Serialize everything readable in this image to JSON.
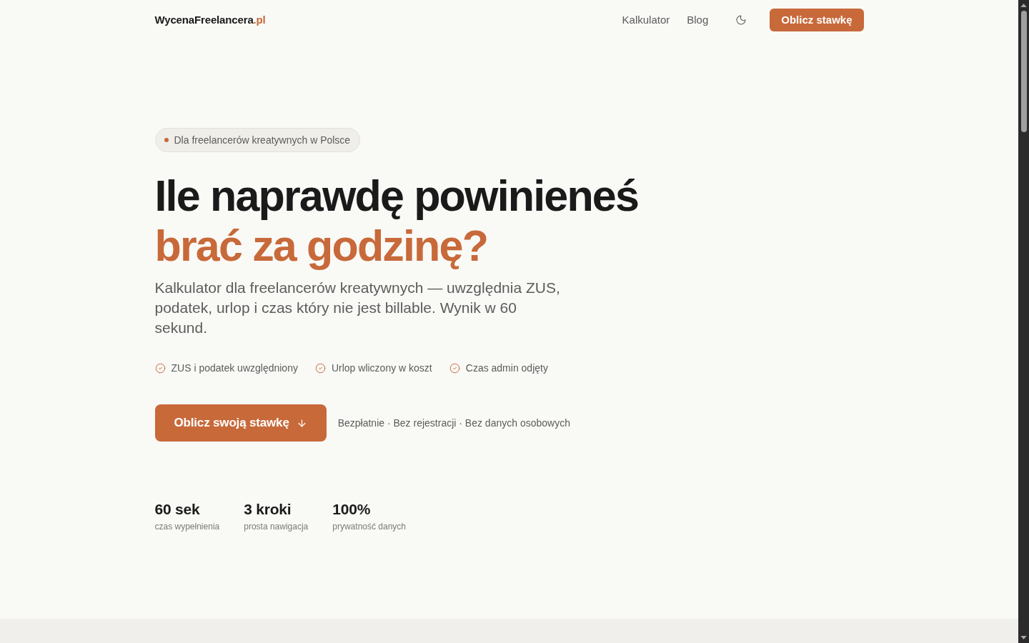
{
  "header": {
    "logo": {
      "name": "WycenaFreelancera",
      "suffix": ".pl"
    },
    "nav": [
      "Kalkulator",
      "Blog"
    ],
    "cta": "Oblicz stawkę"
  },
  "hero": {
    "badge": "Dla freelancerów kreatywnych w Polsce",
    "title_line_1": "Ile naprawdę powinieneś",
    "title_line_2": "brać za godzinę?",
    "lead": "Kalkulator dla freelancerów kreatywnych — uwzględnia ZUS, podatek, urlop i czas który nie jest billable. Wynik w 60 sekund.",
    "features": [
      "ZUS i podatek uwzględniony",
      "Urlop wliczony w koszt",
      "Czas admin odjęty"
    ],
    "cta": "Oblicz swoją stawkę",
    "note": "Bezpłatnie · Bez rejestracji · Bez danych osobowych",
    "stats": [
      {
        "value": "60 sek",
        "label": "czas wypełnienia"
      },
      {
        "value": "3 kroki",
        "label": "prosta nawigacja"
      },
      {
        "value": "100%",
        "label": "prywatność danych"
      }
    ]
  }
}
